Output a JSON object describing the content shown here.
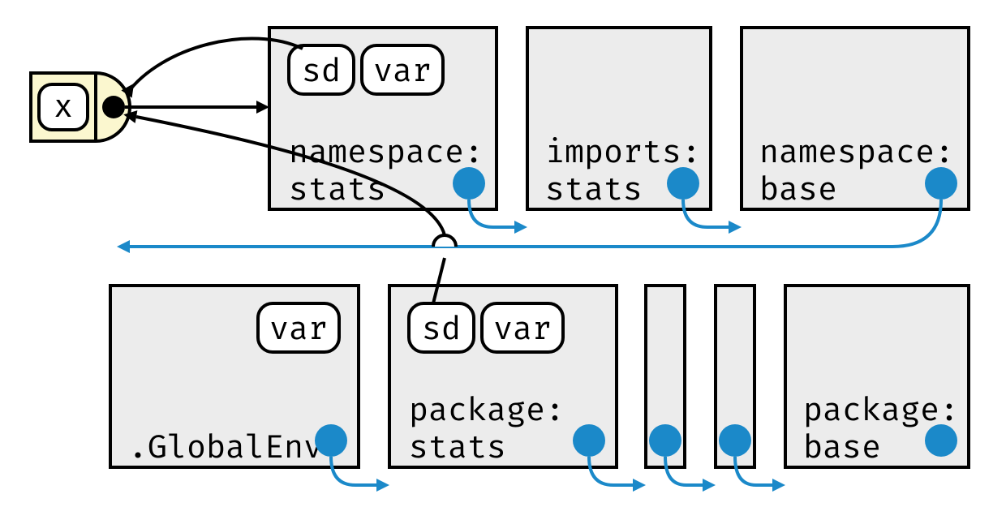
{
  "closure": {
    "arg_label": "x"
  },
  "top_row": {
    "namespace_stats": {
      "label_line1": "namespace:",
      "label_line2": "stats",
      "pills": [
        "sd",
        "var"
      ]
    },
    "imports_stats": {
      "label_line1": "imports:",
      "label_line2": "stats",
      "pills": []
    },
    "namespace_base": {
      "label_line1": "namespace:",
      "label_line2": "base",
      "pills": []
    }
  },
  "bottom_row": {
    "globalenv": {
      "label_line1": ".GlobalEnv",
      "label_line2": "",
      "pills": [
        "var"
      ]
    },
    "package_stats": {
      "label_line1": "package:",
      "label_line2": "stats",
      "pills": [
        "sd",
        "var"
      ]
    },
    "spacer1": {
      "pills": []
    },
    "spacer2": {
      "pills": []
    },
    "package_base": {
      "label_line1": "package:",
      "label_line2": "base",
      "pills": []
    }
  }
}
